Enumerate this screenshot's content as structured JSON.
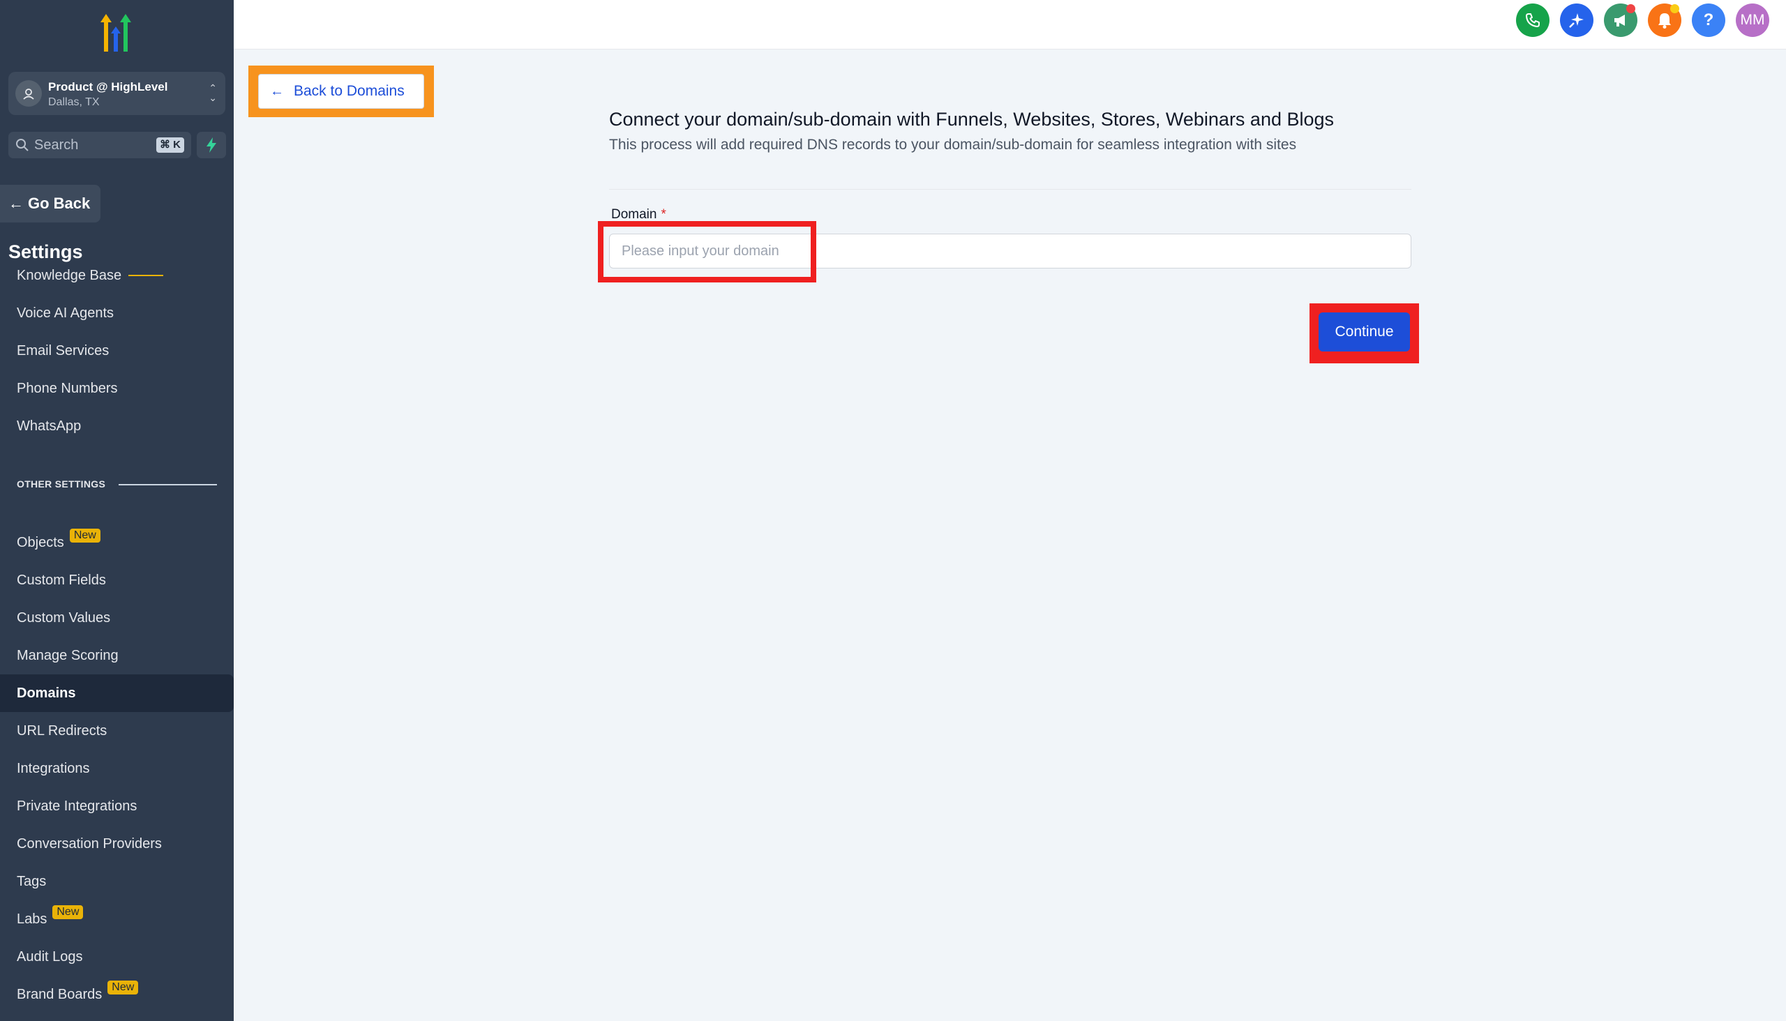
{
  "sidebar": {
    "account": {
      "name": "Product @ HighLevel",
      "location": "Dallas, TX"
    },
    "search": {
      "label": "Search",
      "shortcut": "⌘ K"
    },
    "go_back": "Go Back",
    "settings_title": "Settings",
    "items_top": [
      {
        "label": "Knowledge Base"
      },
      {
        "label": "Voice AI Agents"
      },
      {
        "label": "Email Services"
      },
      {
        "label": "Phone Numbers"
      },
      {
        "label": "WhatsApp"
      }
    ],
    "section_other": "OTHER SETTINGS",
    "items_other": [
      {
        "label": "Objects",
        "badge": "New"
      },
      {
        "label": "Custom Fields"
      },
      {
        "label": "Custom Values"
      },
      {
        "label": "Manage Scoring"
      },
      {
        "label": "Domains",
        "active": true
      },
      {
        "label": "URL Redirects"
      },
      {
        "label": "Integrations"
      },
      {
        "label": "Private Integrations"
      },
      {
        "label": "Conversation Providers"
      },
      {
        "label": "Tags"
      },
      {
        "label": "Labs",
        "badge": "New"
      },
      {
        "label": "Audit Logs"
      },
      {
        "label": "Brand Boards",
        "badge": "New"
      }
    ]
  },
  "topbar": {
    "icons": [
      {
        "name": "phone-icon",
        "color": "#16a34a"
      },
      {
        "name": "sparkle-icon",
        "color": "#2563eb"
      },
      {
        "name": "megaphone-icon",
        "color": "#3a9a6e"
      },
      {
        "name": "bell-icon",
        "color": "#f97316"
      },
      {
        "name": "help-icon",
        "color": "#3b82f6"
      }
    ],
    "user_initials": "MM",
    "avatar_color": "#b76fc7"
  },
  "main": {
    "back_button": "Back to Domains",
    "heading": "Connect your domain/sub-domain with Funnels, Websites, Stores, Webinars and Blogs",
    "subheading": "This process will add required DNS records to your domain/sub-domain for seamless integration with sites",
    "domain_label": "Domain",
    "required_mark": "*",
    "domain_placeholder": "Please input your domain",
    "domain_value": "",
    "continue_button": "Continue"
  },
  "colors": {
    "sidebar_bg": "#2e3b4e",
    "primary": "#1d4ed8",
    "highlight_red": "#ef2020",
    "highlight_orange": "#f7931e",
    "badge_yellow": "#eab308"
  }
}
